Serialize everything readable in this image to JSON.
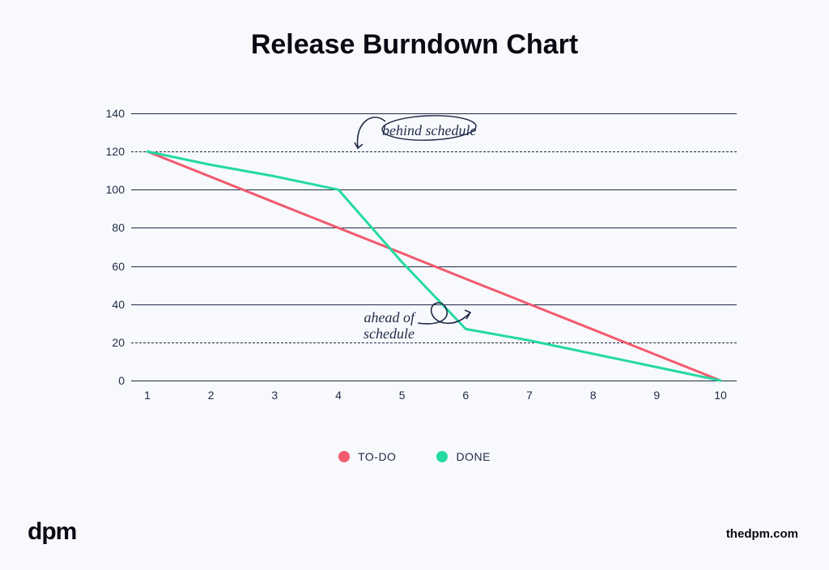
{
  "title": "Release Burndown Chart",
  "footer_logo": "dpm",
  "footer_site": "thedpm.com",
  "legend": {
    "todo": "TO-DO",
    "done": "DONE"
  },
  "colors": {
    "todo": "#f25a6e",
    "done": "#24d9a2",
    "ink": "#1e2a47"
  },
  "annotations": {
    "behind": "behind schedule",
    "ahead": "ahead of\nschedule"
  },
  "chart_data": {
    "type": "line",
    "title": "Release Burndown Chart",
    "xlabel": "",
    "ylabel": "",
    "ylim": [
      0,
      140
    ],
    "x": [
      1,
      2,
      3,
      4,
      5,
      6,
      7,
      8,
      9,
      10
    ],
    "y_ticks": [
      0,
      20,
      40,
      60,
      80,
      100,
      120,
      140
    ],
    "dashed_gridlines": [
      20,
      120
    ],
    "series": [
      {
        "name": "TO-DO",
        "color": "#f25a6e",
        "values": [
          120,
          106.7,
          93.3,
          80,
          66.7,
          53.3,
          40,
          26.7,
          13.3,
          0
        ]
      },
      {
        "name": "DONE",
        "color": "#24d9a2",
        "values": [
          120,
          113,
          107,
          100,
          62,
          27,
          21,
          14,
          7,
          0
        ]
      }
    ],
    "annotations": [
      {
        "text": "behind schedule",
        "region": "above-ideal-early"
      },
      {
        "text": "ahead of schedule",
        "region": "below-ideal-mid"
      }
    ]
  }
}
